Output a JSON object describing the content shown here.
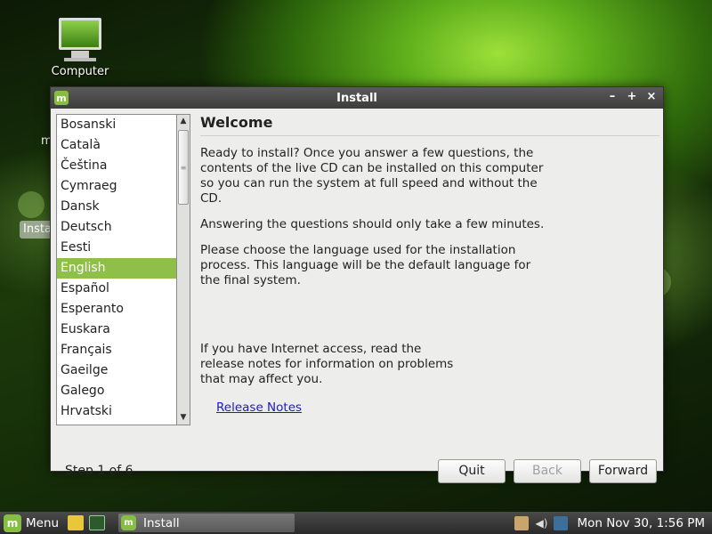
{
  "desktop": {
    "icon_label": "Computer",
    "partial_label": "Insta",
    "partial_char": "m"
  },
  "window": {
    "title": "Install",
    "controls": [
      "–",
      "+",
      "×"
    ]
  },
  "languages": [
    "Bosanski",
    "Català",
    "Čeština",
    "Cymraeg",
    "Dansk",
    "Deutsch",
    "Eesti",
    "English",
    "Español",
    "Esperanto",
    "Euskara",
    "Français",
    "Gaeilge",
    "Galego",
    "Hrvatski"
  ],
  "selected_language": "English",
  "panel": {
    "heading": "Welcome",
    "para1": "Ready to install? Once you answer a few questions, the contents of the live CD can be installed on this computer so you can run the system at full speed and without the CD.",
    "para2": "Answering the questions should only take a few minutes.",
    "para3": "Please choose the language used for the installation process. This language will be the default language for the final system.",
    "para4": "If you have Internet access, read the release notes for information on problems that may affect you.",
    "release_link": "Release Notes"
  },
  "footer": {
    "step": "Step 1 of 6",
    "quit": "Quit",
    "back": "Back",
    "forward": "Forward"
  },
  "taskbar": {
    "menu_label": "Menu",
    "task_label": "Install",
    "clock": "Mon Nov 30,  1:56 PM"
  },
  "colors": {
    "selection": "#8ebf48",
    "mint_green": "#86be43",
    "link": "#1a1acc"
  }
}
